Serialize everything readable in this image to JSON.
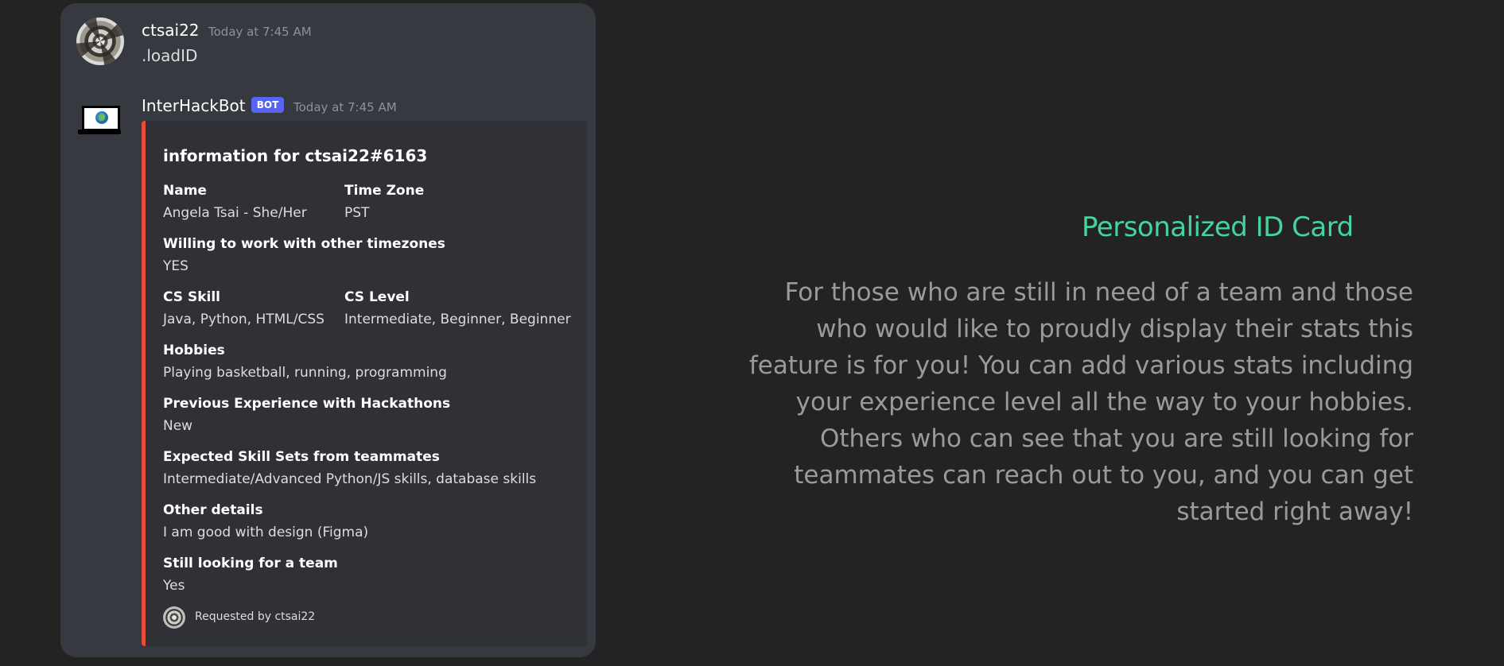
{
  "chat": {
    "user_message": {
      "username": "ctsai22",
      "timestamp": "Today at 7:45 AM",
      "text": ".loadID"
    },
    "bot_message": {
      "name": "InterHackBot",
      "badge": "BOT",
      "timestamp": "Today at 7:45 AM",
      "embed": {
        "title": "information for ctsai22#6163",
        "fields": [
          {
            "name": "Name",
            "value": "Angela Tsai - She/Her"
          },
          {
            "name": "Time Zone",
            "value": "PST"
          },
          {
            "name": "Willing to work with other timezones",
            "value": "YES"
          },
          {
            "name": "CS Skill",
            "value": "Java, Python, HTML/CSS"
          },
          {
            "name": "CS Level",
            "value": "Intermediate, Beginner, Beginner"
          },
          {
            "name": "Hobbies",
            "value": "Playing basketball, running, programming"
          },
          {
            "name": "Previous Experience with Hackathons",
            "value": "New"
          },
          {
            "name": "Expected Skill Sets from teammates",
            "value": "Intermediate/Advanced Python/JS skills, database skills"
          },
          {
            "name": "Other details",
            "value": "I am good with design (Figma)"
          },
          {
            "name": "Still looking for a team",
            "value": "Yes"
          }
        ],
        "footer": "Requested by ctsai22"
      }
    }
  },
  "feature": {
    "title": "Personalized ID Card",
    "description": "For those who are still in need of a team and those who would like to proudly display their stats this feature is for you! You can add various stats including your experience level all the way to your hobbies. Others who can see that you are still looking for teammates can reach out to you, and you can get started right away!"
  },
  "colors": {
    "accent_green": "#45d39e",
    "embed_red": "#e74c3c",
    "bot_badge_blue": "#5865f2"
  }
}
